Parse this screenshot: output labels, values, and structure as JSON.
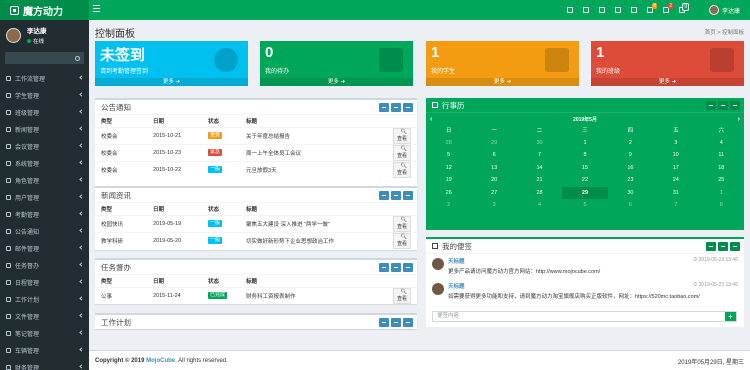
{
  "app": {
    "logo_text": "魔方动力"
  },
  "topbar": {
    "icons": [
      {
        "name": "home-icon",
        "badge": ""
      },
      {
        "name": "grid-icon",
        "badge": ""
      },
      {
        "name": "plus-icon",
        "badge": ""
      },
      {
        "name": "user-icon",
        "badge": ""
      },
      {
        "name": "comment-icon",
        "badge": ""
      },
      {
        "name": "bell-icon",
        "badge": "8"
      },
      {
        "name": "task-icon",
        "badge": "2"
      },
      {
        "name": "flag-icon",
        "badge": "9"
      }
    ],
    "user_name": "李达康"
  },
  "sidebar": {
    "user_name": "李达康",
    "status": "在线",
    "items": [
      {
        "label": "工作流管理",
        "icon": "share-icon"
      },
      {
        "label": "学生管理",
        "icon": "user-icon"
      },
      {
        "label": "班级管理",
        "icon": "users-icon"
      },
      {
        "label": "新闻管理",
        "icon": "news-icon"
      },
      {
        "label": "会议管理",
        "icon": "meeting-icon"
      },
      {
        "label": "系统管理",
        "icon": "gear-icon"
      },
      {
        "label": "角色管理",
        "icon": "role-icon"
      },
      {
        "label": "用户管理",
        "icon": "user-icon"
      },
      {
        "label": "考勤管理",
        "icon": "clock-icon"
      },
      {
        "label": "公告通知",
        "icon": "bullhorn-icon"
      },
      {
        "label": "邮件管理",
        "icon": "mail-icon"
      },
      {
        "label": "任务督办",
        "icon": "task-icon"
      },
      {
        "label": "日程管理",
        "icon": "calendar-icon"
      },
      {
        "label": "工作计划",
        "icon": "plan-icon"
      },
      {
        "label": "文件管理",
        "icon": "file-icon"
      },
      {
        "label": "笔记管理",
        "icon": "note-icon"
      },
      {
        "label": "车辆管理",
        "icon": "car-icon"
      },
      {
        "label": "财务管理",
        "icon": "money-icon"
      }
    ]
  },
  "page": {
    "title": "控制面板",
    "breadcrumb_home": "首页",
    "breadcrumb_current": "控制面板"
  },
  "stats": [
    {
      "value": "未签到",
      "label": "请到考勤管理签到",
      "more": "更多",
      "color": "#00c0ef",
      "icon": "clock-icon"
    },
    {
      "value": "0",
      "label": "我的待办",
      "more": "更多",
      "color": "#00a65a",
      "icon": "sitemap-icon"
    },
    {
      "value": "1",
      "label": "我的学生",
      "more": "更多",
      "color": "#f39c12",
      "icon": "user-icon"
    },
    {
      "value": "1",
      "label": "我的班级",
      "more": "更多",
      "color": "#dd4b39",
      "icon": "bank-icon"
    }
  ],
  "notice": {
    "title": "公告通知",
    "headers": [
      "类型",
      "日期",
      "状态",
      "标题"
    ],
    "rows": [
      {
        "type": "校委会",
        "date": "2015-10-21",
        "status": "重要",
        "status_color": "#f39c12",
        "title": "关于年度总结报告",
        "action": "查看"
      },
      {
        "type": "校委会",
        "date": "2015-10-23",
        "status": "紧急",
        "status_color": "#dd4b39",
        "title": "周一上午全体员工会议",
        "action": "查看"
      },
      {
        "type": "校委会",
        "date": "2015-10-22",
        "status": "一般",
        "status_color": "#00c0ef",
        "title": "元旦放假3天",
        "action": "查看"
      }
    ]
  },
  "news": {
    "title": "新闻资讯",
    "headers": [
      "类型",
      "日期",
      "状态",
      "标题"
    ],
    "rows": [
      {
        "type": "校园快讯",
        "date": "2019-05-19",
        "status": "一般",
        "status_color": "#00c0ef",
        "title": "聚焦五大建设 深入推进 “两学一做”",
        "action": "查看"
      },
      {
        "type": "教学科研",
        "date": "2019-05-20",
        "status": "一般",
        "status_color": "#00c0ef",
        "title": "切实做好新形势下企业思想政治工作",
        "action": "查看"
      }
    ]
  },
  "tasks": {
    "title": "任务督办",
    "headers": [
      "类型",
      "日期",
      "状态",
      "标题"
    ],
    "rows": [
      {
        "type": "公事",
        "date": "2015-11-24",
        "status": "已完成",
        "status_color": "#00a65a",
        "title": "财务科工资报表制作",
        "action": "查看"
      }
    ]
  },
  "plan": {
    "title": "工作计划"
  },
  "calendar": {
    "title": "行事历",
    "month_label": "2019年5月",
    "weekdays": [
      "日",
      "一",
      "二",
      "三",
      "四",
      "五",
      "六"
    ],
    "weeks": [
      [
        [
          "28",
          1
        ],
        [
          "29",
          1
        ],
        [
          "30",
          1
        ],
        [
          "1",
          0
        ],
        [
          "2",
          0
        ],
        [
          "3",
          0
        ],
        [
          "4",
          0
        ]
      ],
      [
        [
          "5",
          0
        ],
        [
          "6",
          0
        ],
        [
          "7",
          0
        ],
        [
          "8",
          0
        ],
        [
          "9",
          0
        ],
        [
          "10",
          0
        ],
        [
          "11",
          0
        ]
      ],
      [
        [
          "12",
          0
        ],
        [
          "13",
          0
        ],
        [
          "14",
          0
        ],
        [
          "15",
          0
        ],
        [
          "16",
          0
        ],
        [
          "17",
          0
        ],
        [
          "18",
          0
        ]
      ],
      [
        [
          "19",
          0
        ],
        [
          "20",
          0
        ],
        [
          "21",
          0
        ],
        [
          "22",
          0
        ],
        [
          "23",
          0
        ],
        [
          "24",
          0
        ],
        [
          "25",
          0
        ]
      ],
      [
        [
          "26",
          0
        ],
        [
          "27",
          0
        ],
        [
          "28",
          0
        ],
        [
          "29",
          2
        ],
        [
          "30",
          0
        ],
        [
          "31",
          0
        ],
        [
          "1",
          1
        ]
      ],
      [
        [
          "2",
          1
        ],
        [
          "3",
          1
        ],
        [
          "4",
          1
        ],
        [
          "5",
          1
        ],
        [
          "6",
          1
        ],
        [
          "7",
          1
        ],
        [
          "8",
          1
        ]
      ]
    ]
  },
  "memo": {
    "title": "我的便签",
    "messages": [
      {
        "name": "天标题",
        "time": "2019-05-23 13:46",
        "text": "更多产品请访问魔方动力官方网站：http://www.mojocube.com/"
      },
      {
        "name": "天标题",
        "time": "2019-05-23 13:46",
        "text": "如需要获得更多功能和支持，请到魔方动力淘宝旗舰店购买正版软件，网址：https://520mc.taobao.com/"
      }
    ],
    "input_placeholder": "便签内容"
  },
  "footer": {
    "copyright_prefix": "Copyright © 2019",
    "brand": "MojoCube",
    "suffix": ". All rights reserved.",
    "date": "2019年05月29日, 星期三"
  }
}
